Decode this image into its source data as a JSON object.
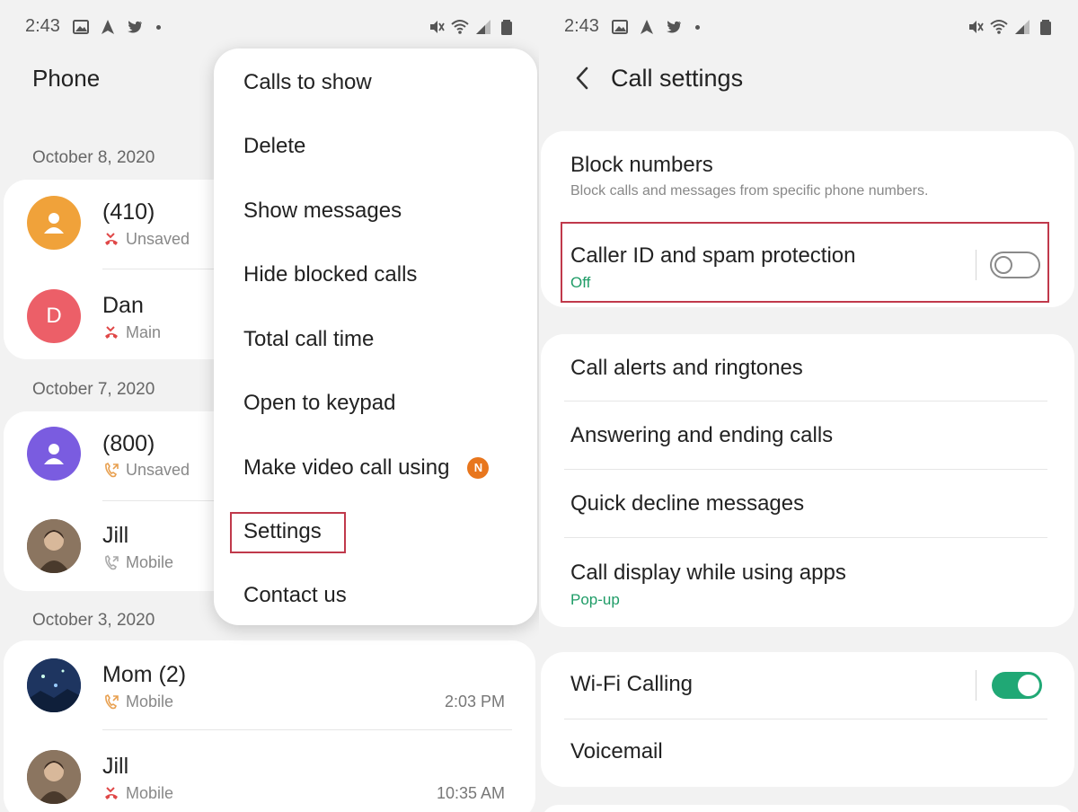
{
  "status_bar": {
    "time": "2:43"
  },
  "phone_app": {
    "title": "Phone",
    "groups": [
      {
        "date": "October 8, 2020",
        "calls": [
          {
            "name": "(410)",
            "type": "Unsaved",
            "call_icon": "missed-call-icon",
            "avatar_letter": "",
            "avatar_color": "#f0a23a",
            "time": ""
          },
          {
            "name": "Dan",
            "type": "Main",
            "call_icon": "missed-call-icon",
            "avatar_letter": "D",
            "avatar_color": "#ec5f68",
            "time": ""
          }
        ]
      },
      {
        "date": "October 7, 2020",
        "calls": [
          {
            "name": "(800)",
            "type": "Unsaved",
            "call_icon": "outgoing-call-icon",
            "avatar_letter": "",
            "avatar_color": "#7a5ce0",
            "time": ""
          },
          {
            "name": "Jill",
            "type": "Mobile",
            "call_icon": "outgoing-call-icon",
            "avatar_letter": "",
            "avatar_color": "#6b5a4a",
            "time": ""
          }
        ]
      },
      {
        "date": "October 3, 2020",
        "calls": [
          {
            "name": "Mom (2)",
            "type": "Mobile",
            "call_icon": "outgoing-call-icon",
            "avatar_letter": "",
            "avatar_color": "#2f4c8a",
            "time": "2:03 PM"
          },
          {
            "name": "Jill",
            "type": "Mobile",
            "call_icon": "missed-call-icon",
            "avatar_letter": "",
            "avatar_color": "#6b5a4a",
            "time": "10:35 AM"
          }
        ]
      }
    ]
  },
  "popup_menu": {
    "items": [
      "Calls to show",
      "Delete",
      "Show messages",
      "Hide blocked calls",
      "Total call time",
      "Open to keypad",
      "Make video call using",
      "Settings",
      "Contact us"
    ],
    "badge": "N",
    "highlighted_item": "Settings"
  },
  "call_settings": {
    "title": "Call settings",
    "block_numbers": {
      "title": "Block numbers",
      "subtitle": "Block calls and messages from specific phone numbers."
    },
    "caller_id": {
      "title": "Caller ID and spam protection",
      "status": "Off",
      "enabled": false
    },
    "section2": [
      {
        "title": "Call alerts and ringtones",
        "status": ""
      },
      {
        "title": "Answering and ending calls",
        "status": ""
      },
      {
        "title": "Quick decline messages",
        "status": ""
      },
      {
        "title": "Call display while using apps",
        "status": "Pop-up"
      }
    ],
    "wifi_calling": {
      "title": "Wi-Fi Calling",
      "enabled": true
    },
    "voicemail": {
      "title": "Voicemail"
    }
  },
  "colors": {
    "accent_green": "#20a875",
    "highlight_red": "#c0394b",
    "badge_orange": "#e8761d"
  }
}
